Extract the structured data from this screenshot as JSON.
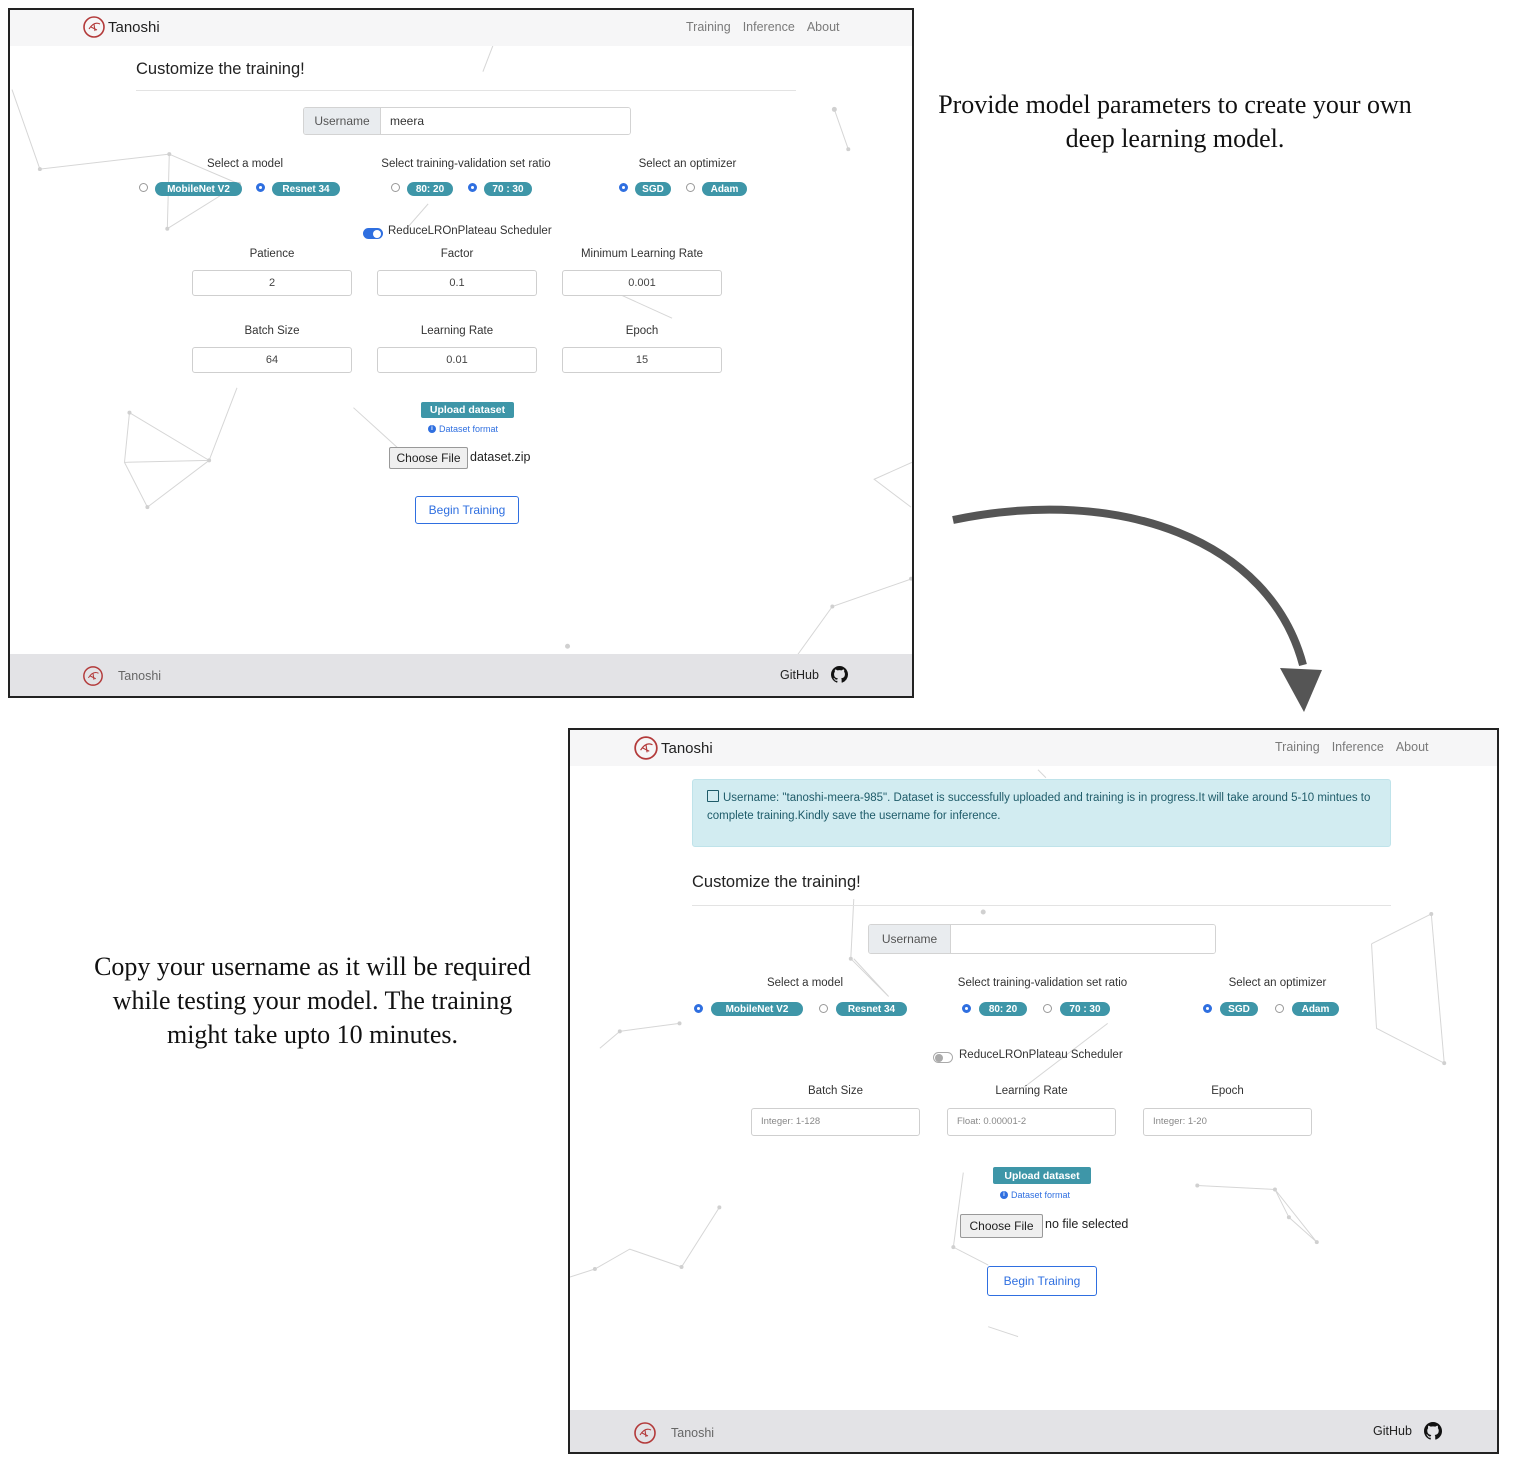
{
  "screen1": {
    "brand": "Tanoshi",
    "nav": [
      "Training",
      "Inference",
      "About"
    ],
    "title": "Customize the training!",
    "username_label": "Username",
    "username_value": "meera",
    "model": {
      "label": "Select a model",
      "options": [
        "MobileNet V2",
        "Resnet 34"
      ],
      "selected": "Resnet 34"
    },
    "ratio": {
      "label": "Select training-validation set ratio",
      "options": [
        "80: 20",
        "70 : 30"
      ],
      "selected": "70 : 30"
    },
    "optimizer": {
      "label": "Select an optimizer",
      "options": [
        "SGD",
        "Adam"
      ],
      "selected": "SGD"
    },
    "scheduler": {
      "label": "ReduceLROnPlateau Scheduler",
      "enabled": true
    },
    "patience": {
      "label": "Patience",
      "value": "2"
    },
    "factor": {
      "label": "Factor",
      "value": "0.1"
    },
    "min_lr": {
      "label": "Minimum Learning Rate",
      "value": "0.001"
    },
    "batch_size": {
      "label": "Batch Size",
      "value": "64"
    },
    "learning_rate": {
      "label": "Learning Rate",
      "value": "0.01"
    },
    "epoch": {
      "label": "Epoch",
      "value": "15"
    },
    "upload_label": "Upload dataset",
    "dataset_format": "Dataset format",
    "choose_file": "Choose File",
    "file_name": "dataset.zip",
    "begin": "Begin Training",
    "footer_brand": "Tanoshi",
    "github": "GitHub"
  },
  "screen2": {
    "brand": "Tanoshi",
    "nav": [
      "Training",
      "Inference",
      "About"
    ],
    "alert": "Username: \"tanoshi-meera-985\". Dataset is successfully uploaded and training is in progress.It will take around 5-10 mintues to complete training.Kindly save the username for inference.",
    "title": "Customize the training!",
    "username_label": "Username",
    "username_value": "",
    "model": {
      "label": "Select a model",
      "options": [
        "MobileNet V2",
        "Resnet 34"
      ],
      "selected": "MobileNet V2"
    },
    "ratio": {
      "label": "Select training-validation set ratio",
      "options": [
        "80: 20",
        "70 : 30"
      ],
      "selected": "80: 20"
    },
    "optimizer": {
      "label": "Select an optimizer",
      "options": [
        "SGD",
        "Adam"
      ],
      "selected": "SGD"
    },
    "scheduler": {
      "label": "ReduceLROnPlateau Scheduler",
      "enabled": false
    },
    "batch_size": {
      "label": "Batch Size",
      "placeholder": "Integer: 1-128"
    },
    "learning_rate": {
      "label": "Learning Rate",
      "placeholder": "Float: 0.00001-2"
    },
    "epoch": {
      "label": "Epoch",
      "placeholder": "Integer: 1-20"
    },
    "upload_label": "Upload dataset",
    "dataset_format": "Dataset format",
    "choose_file": "Choose File",
    "file_name": "no file selected",
    "begin": "Begin Training",
    "footer_brand": "Tanoshi",
    "github": "GitHub"
  },
  "captions": {
    "top": "Provide model parameters to create your own deep learning model.",
    "left": "Copy your username as it will be required while testing your model. The training might take upto 10 minutes."
  },
  "colors": {
    "accent_pill": "#3e96a8",
    "primary": "#2f6fe0",
    "alert_bg": "#d2ecf1",
    "footer_bg": "#e3e3e6"
  }
}
